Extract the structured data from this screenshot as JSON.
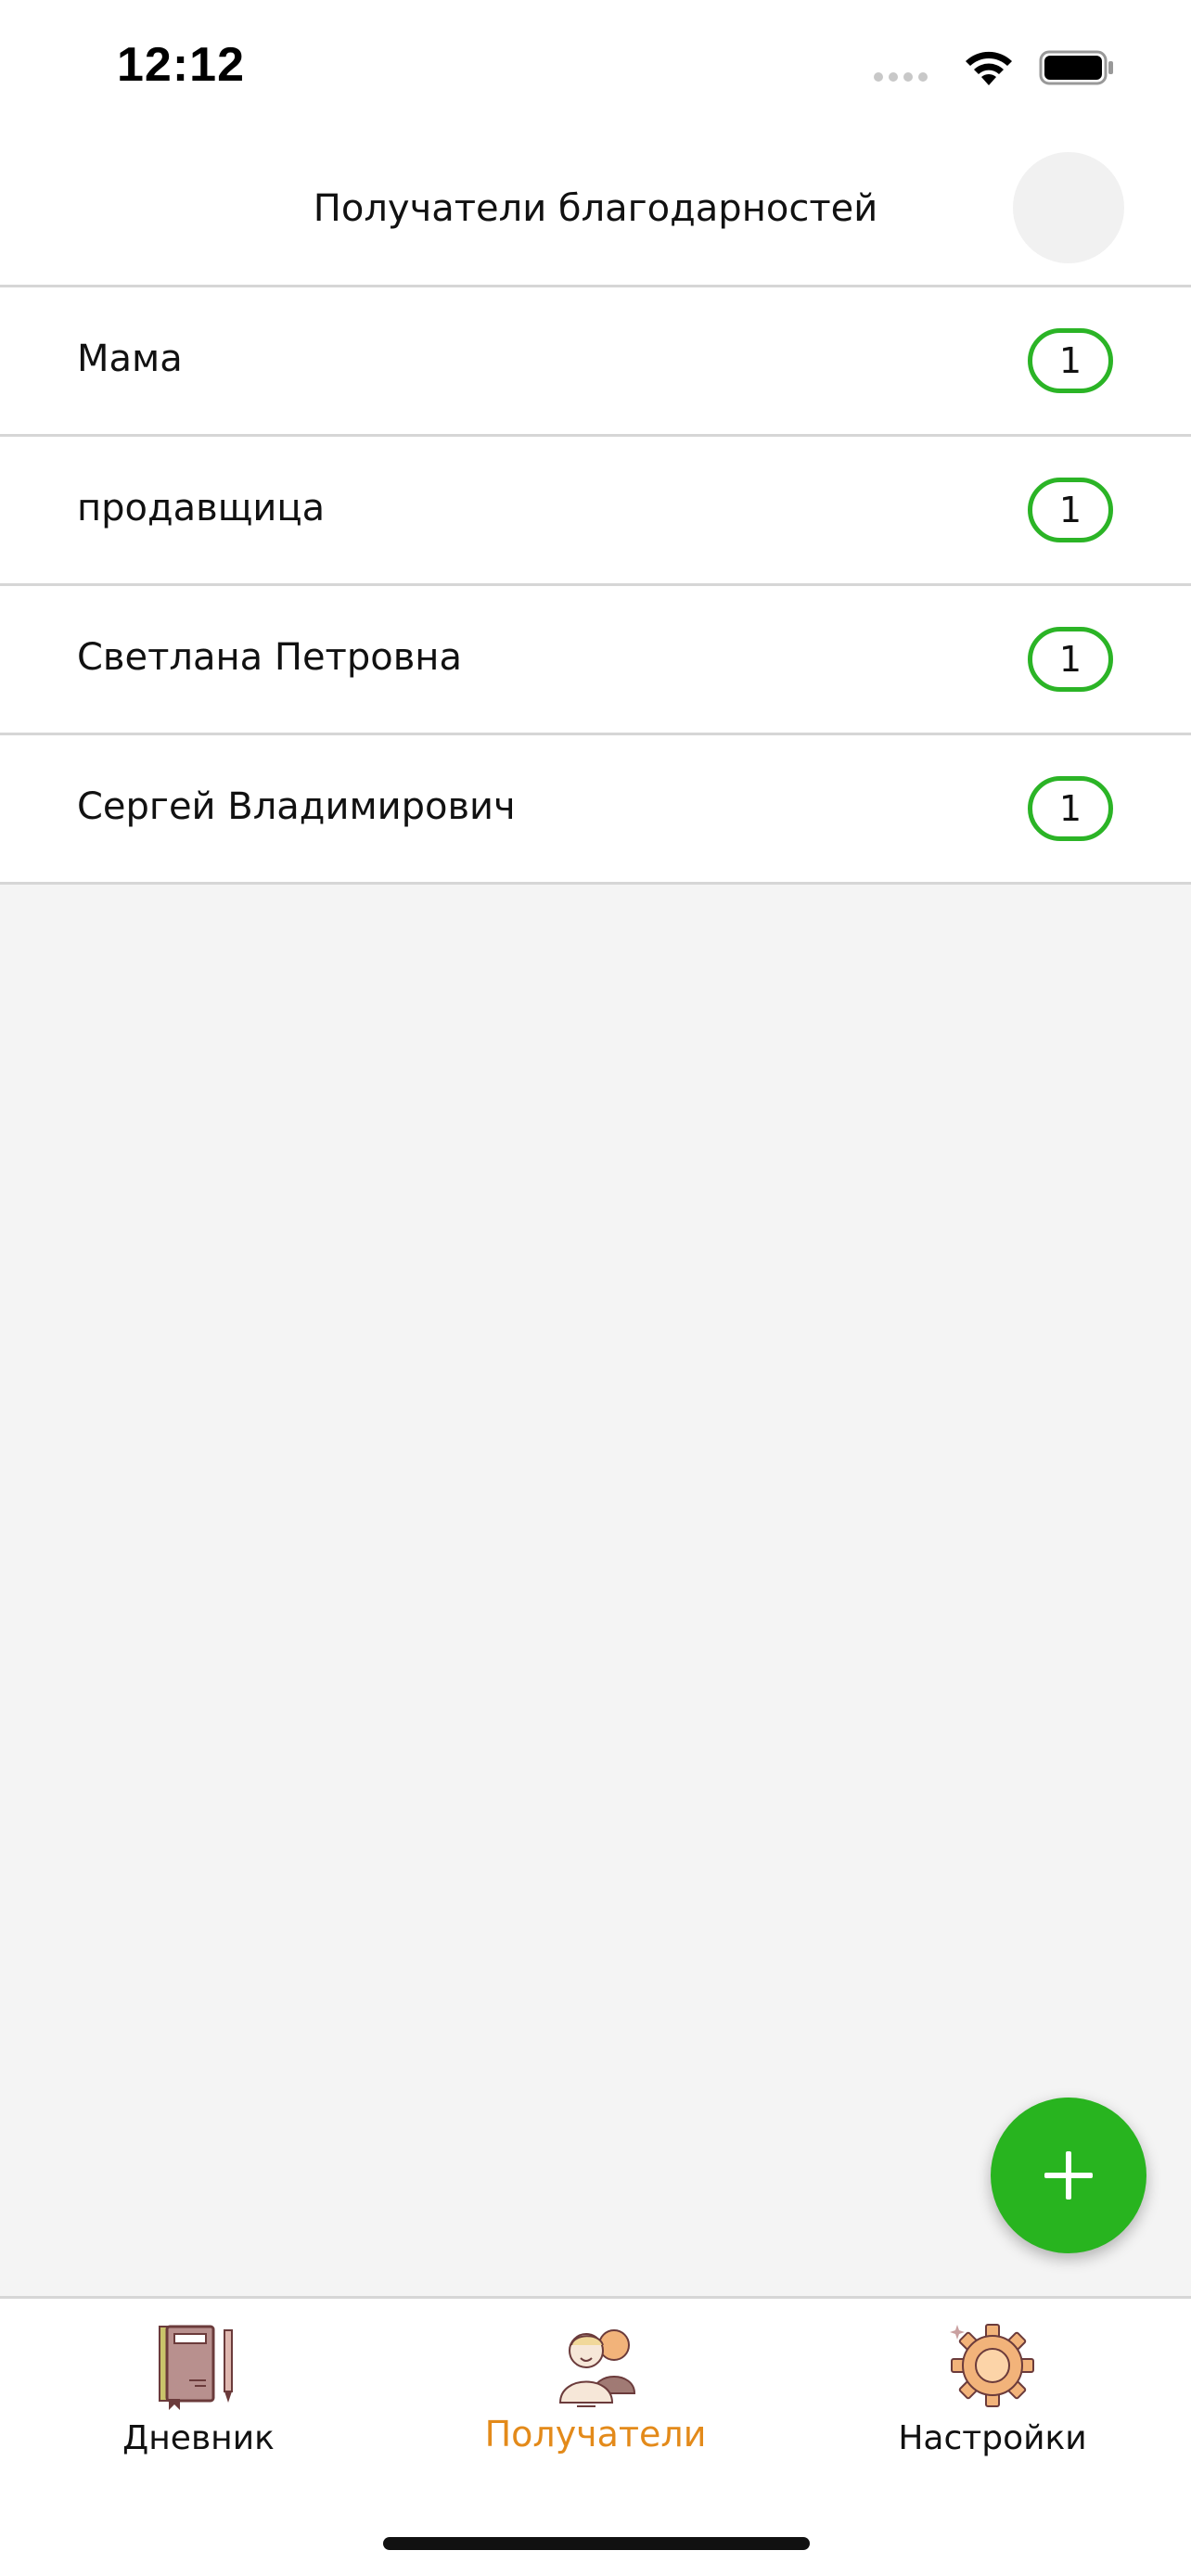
{
  "status_bar": {
    "time": "12:12",
    "icons": [
      "signal-dots",
      "wifi-icon",
      "battery-icon"
    ]
  },
  "header": {
    "title": "Получатели благодарностей"
  },
  "recipients": [
    {
      "name": "Мама",
      "count": "1"
    },
    {
      "name": "продавщица",
      "count": "1"
    },
    {
      "name": "Светлана Петровна",
      "count": "1"
    },
    {
      "name": "Сергей Владимирович",
      "count": "1"
    }
  ],
  "fab": {
    "icon": "plus-icon"
  },
  "tabs": [
    {
      "label": "Дневник",
      "icon": "diary-icon",
      "active": false
    },
    {
      "label": "Получатели",
      "icon": "recipients-icon",
      "active": true
    },
    {
      "label": "Настройки",
      "icon": "gear-icon",
      "active": false
    }
  ],
  "colors": {
    "accent_green": "#28b41f",
    "badge_green": "#2bb426",
    "active_tab": "#e38a1a",
    "background": "#f4f4f4"
  }
}
